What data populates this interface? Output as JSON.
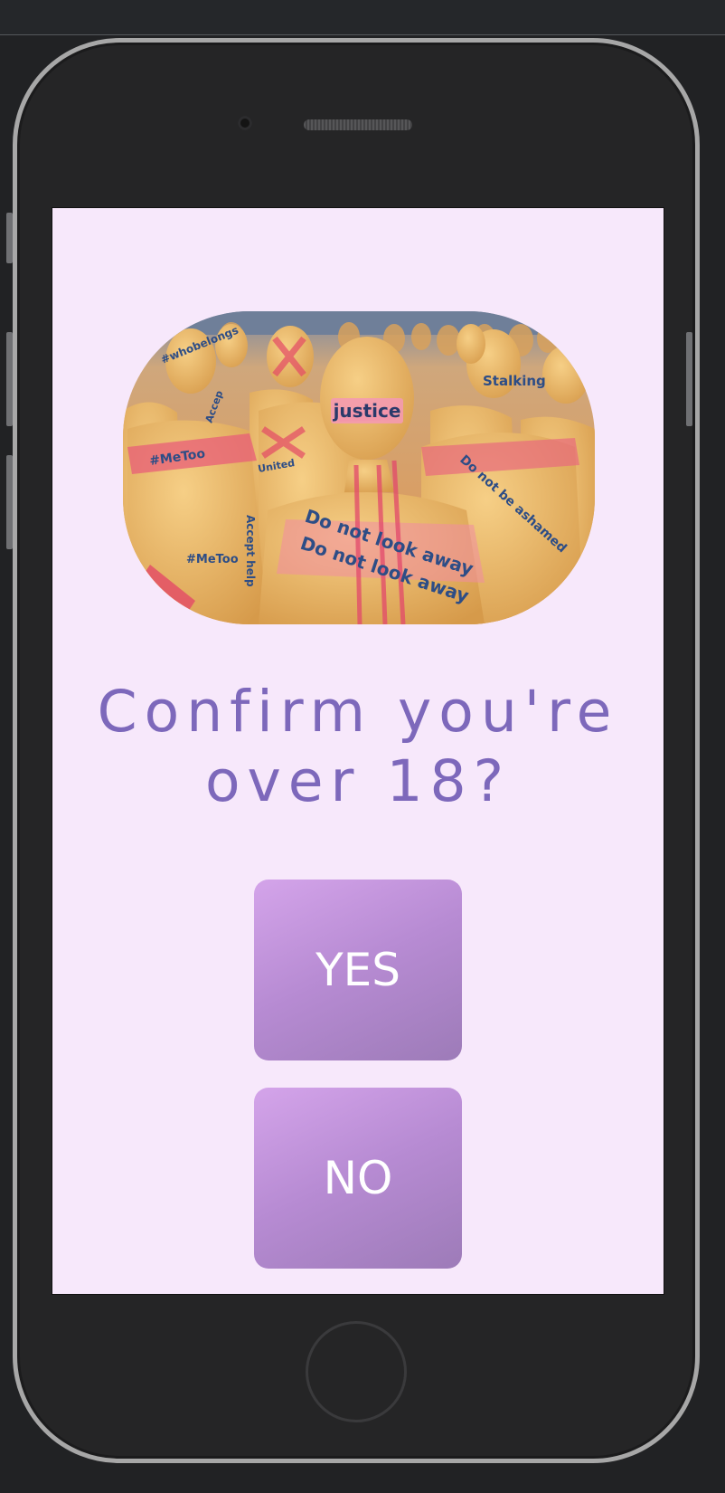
{
  "dialog": {
    "question_line1": "Confirm you're",
    "question_line2": "over 18?",
    "yes_label": "YES",
    "no_label": "NO"
  },
  "image": {
    "alt": "Mannequins wrapped in tape with protest slogans",
    "signs": {
      "justice": "justice",
      "metoo_left": "#MeToo",
      "metoo_lower": "#MeToo",
      "stalking": "Stalking",
      "do_not_look_1": "Do not look away",
      "do_not_look_2": "Do not look away",
      "do_not_be_ashamed": "Do not be ashamed",
      "accept_help": "Accept help",
      "whobelongs": "#whobelongs",
      "accept": "Accep",
      "united": "United"
    }
  },
  "colors": {
    "screen_background": "#f7e8fb",
    "prompt_text": "#7d68bb",
    "button_top": "#d4a4ea",
    "button_bottom": "#9d7bb8",
    "device_body": "#252526",
    "device_frame": "#a7a7a7"
  },
  "icons": {
    "home": "home-button-ring",
    "camera": "front-camera",
    "speaker": "earpiece-speaker"
  }
}
